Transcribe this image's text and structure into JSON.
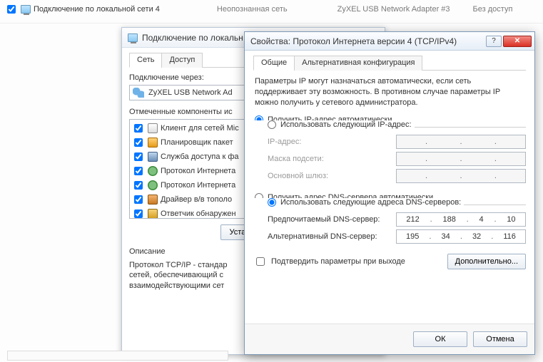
{
  "top_row": {
    "conn_name": "Подключение по локальной сети 4",
    "status": "Неопознанная сеть",
    "adapter": "ZyXEL USB Network Adapter #3",
    "access": "Без доступ"
  },
  "win1": {
    "title": "Подключение по локальн",
    "tabs": {
      "network": "Сеть",
      "access": "Доступ"
    },
    "connect_via": "Подключение через:",
    "adapter": "ZyXEL USB Network Ad",
    "components_label": "Отмеченные компоненты ис",
    "components": [
      "Клиент для сетей Mic",
      "Планировщик пакет",
      "Служба доступа к фа",
      "Протокол Интернета",
      "Протокол Интернета",
      "Драйвер в/в тополо",
      "Ответчик обнаружен"
    ],
    "btn_install": "Установить...",
    "desc_title": "Описание",
    "desc": "Протокол TCP/IP - стандар\nсетей, обеспечивающий с\nвзаимодействующими сет"
  },
  "win2": {
    "title": "Свойства: Протокол Интернета версии 4 (TCP/IPv4)",
    "tabs": {
      "general": "Общие",
      "alt": "Альтернативная конфигурация"
    },
    "help": "Параметры IP могут назначаться автоматически, если сеть поддерживает эту возможность. В противном случае параметры IP можно получить у сетевого администратора.",
    "ip_auto": "Получить IP-адрес автоматически",
    "ip_manual": "Использовать следующий IP-адрес:",
    "ip_addr_label": "IP-адрес:",
    "mask_label": "Маска подсети:",
    "gw_label": "Основной шлюз:",
    "dns_auto": "Получить адрес DNS-сервера автоматически",
    "dns_manual": "Использовать следующие адреса DNS-серверов:",
    "dns1_label": "Предпочитаемый DNS-сервер:",
    "dns2_label": "Альтернативный DNS-сервер:",
    "dns1": [
      "212",
      "188",
      "4",
      "10"
    ],
    "dns2": [
      "195",
      "34",
      "32",
      "116"
    ],
    "confirm_on_exit": "Подтвердить параметры при выходе",
    "advanced": "Дополнительно...",
    "ok": "ОК",
    "cancel": "Отмена"
  }
}
